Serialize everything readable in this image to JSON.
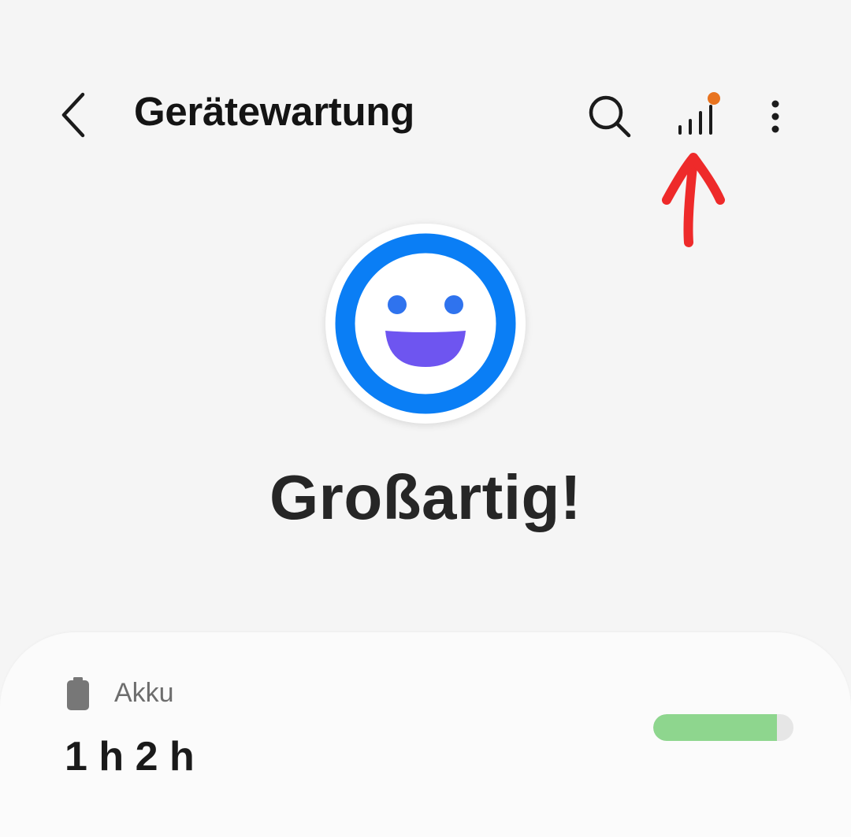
{
  "header": {
    "title": "Gerätewartung",
    "icons": {
      "back": "chevron-left-icon",
      "search": "search-icon",
      "stats": "bar-chart-icon",
      "more": "more-vertical-icon"
    },
    "notification_dot_color": "#e8731f"
  },
  "status": {
    "label": "Großartig!",
    "icon": "smiley-face-icon",
    "ring_color": "#0a7ef5",
    "mouth_color": "#6e55f0"
  },
  "annotation": {
    "color": "#ee2a2a"
  },
  "battery_card": {
    "title": "Akku",
    "icon": "battery-icon",
    "value": "1 h 2 h",
    "level_fraction": 0.88,
    "bar_color": "#8ed68e"
  }
}
